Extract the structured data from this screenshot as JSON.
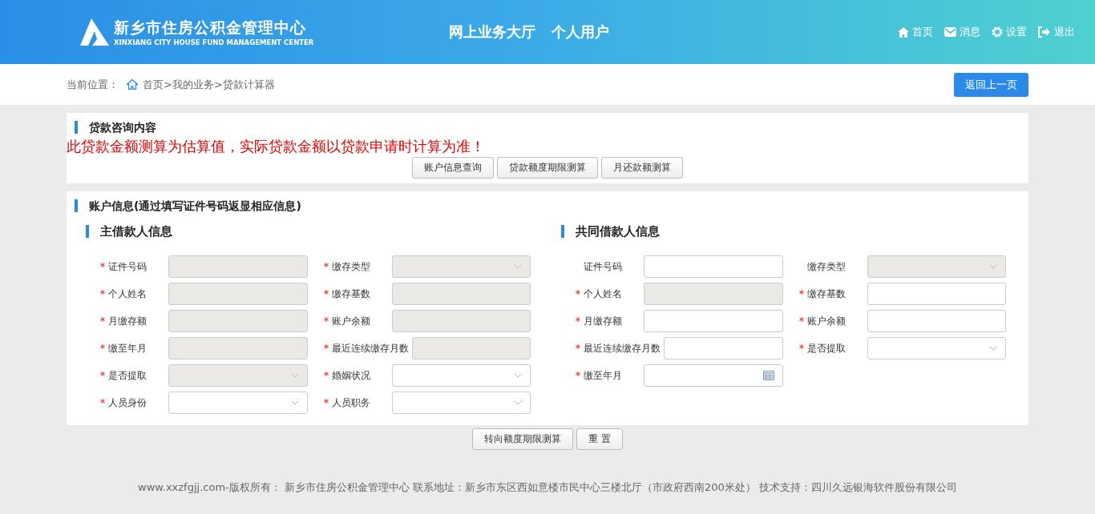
{
  "header": {
    "logo_title": "新乡市住房公积金管理中心",
    "logo_subtitle": "XINXIANG CITY HOUSE FUND MANAGEMENT CENTER",
    "center_titles": [
      "网上业务大厅",
      "个人用户"
    ],
    "nav": [
      {
        "kind": "home",
        "label": "首页"
      },
      {
        "kind": "message",
        "label": "消息"
      },
      {
        "kind": "settings",
        "label": "设置"
      },
      {
        "kind": "logout",
        "label": "退出"
      }
    ]
  },
  "breadcrumb": {
    "prefix": "当前位置：",
    "home": "首页",
    "path": " >我的业务>贷款计算器",
    "back_button": "返回上一页"
  },
  "consult": {
    "title": "贷款咨询内容",
    "notice": "此贷款金额测算为估算值，实际贷款金额以贷款申请时计算为准！",
    "buttons": [
      "账户信息查询",
      "贷款额度期限测算",
      "月还款额测算"
    ]
  },
  "account": {
    "title": "账户信息(通过填写证件号码返显相应信息)",
    "sections": [
      {
        "title": "主借款人信息",
        "fields": [
          {
            "label": "证件号码",
            "kind": "text",
            "required": true,
            "disabled": true
          },
          {
            "label": "缴存类型",
            "kind": "select",
            "required": true,
            "disabled": true
          },
          {
            "label": "个人姓名",
            "kind": "text",
            "required": true,
            "disabled": true
          },
          {
            "label": "缴存基数",
            "kind": "text",
            "required": true,
            "disabled": true
          },
          {
            "label": "月缴存额",
            "kind": "text",
            "required": true,
            "disabled": true
          },
          {
            "label": "账户余额",
            "kind": "text",
            "required": true,
            "disabled": true
          },
          {
            "label": "缴至年月",
            "kind": "text",
            "required": true,
            "disabled": true
          },
          {
            "label": "最近连续缴存月数",
            "kind": "text",
            "required": true,
            "disabled": true
          },
          {
            "label": "是否提取",
            "kind": "select",
            "required": true,
            "disabled": true
          },
          {
            "label": "婚姻状况",
            "kind": "select",
            "required": true,
            "disabled": false
          },
          {
            "label": "人员身份",
            "kind": "select",
            "required": true,
            "disabled": false
          },
          {
            "label": "人员职务",
            "kind": "select",
            "required": true,
            "disabled": false
          }
        ]
      },
      {
        "title": "共同借款人信息",
        "fields": [
          {
            "label": "证件号码",
            "kind": "text",
            "required": false,
            "disabled": false
          },
          {
            "label": "缴存类型",
            "kind": "select",
            "required": false,
            "disabled": true
          },
          {
            "label": "个人姓名",
            "kind": "text",
            "required": true,
            "disabled": true
          },
          {
            "label": "缴存基数",
            "kind": "text",
            "required": true,
            "disabled": false
          },
          {
            "label": "月缴存额",
            "kind": "text",
            "required": true,
            "disabled": false
          },
          {
            "label": "账户余额",
            "kind": "text",
            "required": true,
            "disabled": false
          },
          {
            "label": "最近连续缴存月数",
            "kind": "text",
            "required": true,
            "disabled": false
          },
          {
            "label": "是否提取",
            "kind": "select",
            "required": true,
            "disabled": false
          },
          {
            "label": "缴至年月",
            "kind": "date",
            "required": true,
            "disabled": false
          }
        ]
      }
    ]
  },
  "actions": [
    "转向额度期限测算",
    "重 置"
  ],
  "footer": "www.xxzfgjj.com-版权所有： 新乡市住房公积金管理中心 联系地址：新乡市东区西如意楼市民中心三楼北厅（市政府西南200米处） 技术支持：四川久远银海软件股份有限公司"
}
